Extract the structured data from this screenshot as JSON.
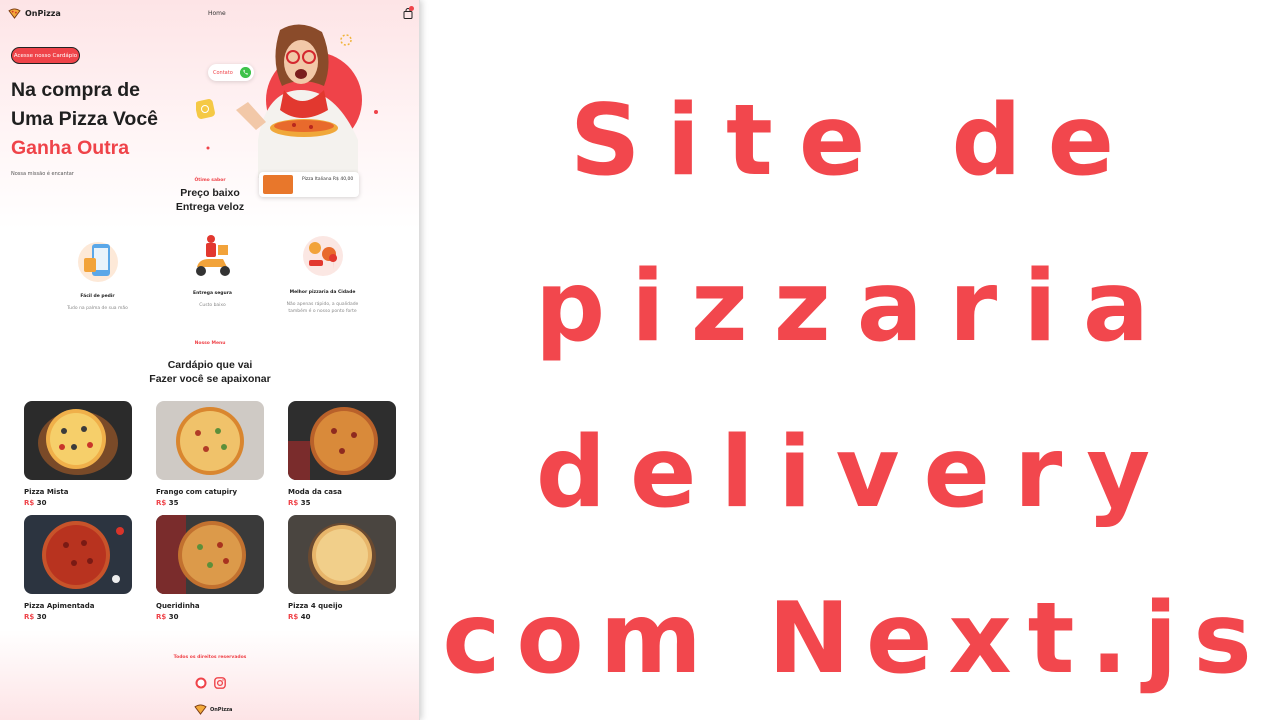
{
  "site": {
    "nav": {
      "logo_text": "OnPizza",
      "home": "Home"
    },
    "hero": {
      "cta": "Acesse nosso Cardápio",
      "title_line1": "Na compra de",
      "title_line2": "Uma Pizza Você",
      "title_line3": "Ganha Outra",
      "subtitle": "Nossa missão é encantar",
      "contact": "Contato",
      "price_card": "Pizza Italiana R$ 40,00"
    },
    "tagline": {
      "small": "Ótimo sabor",
      "line1": "Preço baixo",
      "line2": "Entrega veloz"
    },
    "features": [
      {
        "title": "Fácil de pedir",
        "desc": "Tudo na palma de sua mão"
      },
      {
        "title": "Entrega segura",
        "desc": "Custo baixo"
      },
      {
        "title": "Melhor pizzaria da Cidade",
        "desc": "Não apenas rápido, a qualidade também é o nosso ponto forte"
      }
    ],
    "menu": {
      "small": "Nosso Menu",
      "line1": "Cardápio que vai",
      "line2": "Fazer você se apaixonar",
      "currency": "R$",
      "items": [
        {
          "name": "Pizza Mista",
          "price": "30"
        },
        {
          "name": "Frango com catupiry",
          "price": "35"
        },
        {
          "name": "Moda da casa",
          "price": "35"
        },
        {
          "name": "Pizza Apimentada",
          "price": "30"
        },
        {
          "name": "Queridinha",
          "price": "30"
        },
        {
          "name": "Pizza 4 queijo",
          "price": "40"
        }
      ]
    },
    "footer": {
      "rights": "Todos os direitos reservados",
      "logo_text": "OnPizza"
    }
  },
  "headline": {
    "line1": "Site de",
    "line2": "pizzaria",
    "line3": "delivery",
    "line4": "com Next.js"
  },
  "colors": {
    "accent": "#ef4349",
    "headline": "#f2474d",
    "text": "#1f1f1f"
  }
}
